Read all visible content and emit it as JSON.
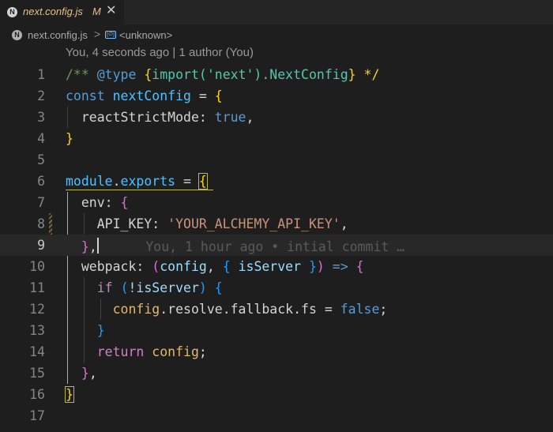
{
  "tab": {
    "file_icon": "N",
    "label": "next.config.js",
    "badge": "M",
    "close": "✕"
  },
  "breadcrumb": {
    "file_icon": "N",
    "file": "next.config.js",
    "separator": ">",
    "symbol_icon": "[∅]",
    "symbol": "<unknown>"
  },
  "codelens": "You, 4 seconds ago | 1 author (You)",
  "blame": "You, 1 hour ago • intial commit …",
  "line_numbers": [
    "1",
    "2",
    "3",
    "4",
    "5",
    "6",
    "7",
    "8",
    "9",
    "10",
    "11",
    "12",
    "13",
    "14",
    "15",
    "16",
    "17"
  ],
  "code": {
    "l1": [
      "/** ",
      "@type",
      " {",
      "import('next').NextConfig",
      "} */"
    ],
    "l2": [
      "const",
      " ",
      "nextConfig",
      " = ",
      "{"
    ],
    "l3": [
      "  reactStrictMode: ",
      "true",
      ","
    ],
    "l4": [
      "}"
    ],
    "l6": [
      "module",
      ".",
      "exports",
      " = ",
      "{"
    ],
    "l7": [
      "  env: ",
      "{"
    ],
    "l8": [
      "    API_KEY: ",
      "'YOUR_ALCHEMY_API_KEY'",
      ","
    ],
    "l9": [
      "  ",
      "}",
      ","
    ],
    "l10": [
      "  webpack: ",
      "(",
      "config",
      ", ",
      "{",
      " isServer ",
      "}",
      ")",
      " => ",
      "{"
    ],
    "l11": [
      "    ",
      "if",
      " ",
      "(",
      "!isServer",
      ")",
      " ",
      "{"
    ],
    "l12": [
      "      ",
      "config",
      ".resolve.fallback.fs",
      " = ",
      "false",
      ";"
    ],
    "l13": [
      "    ",
      "}"
    ],
    "l14": [
      "    ",
      "return",
      " ",
      "config",
      ";"
    ],
    "l15": [
      "  ",
      "}",
      ","
    ],
    "l16": [
      "}"
    ]
  },
  "colors": {
    "editor_bg": "#1e1e1e",
    "modified": "#e2c08d",
    "bracket_highlight": "#b9b94a"
  }
}
